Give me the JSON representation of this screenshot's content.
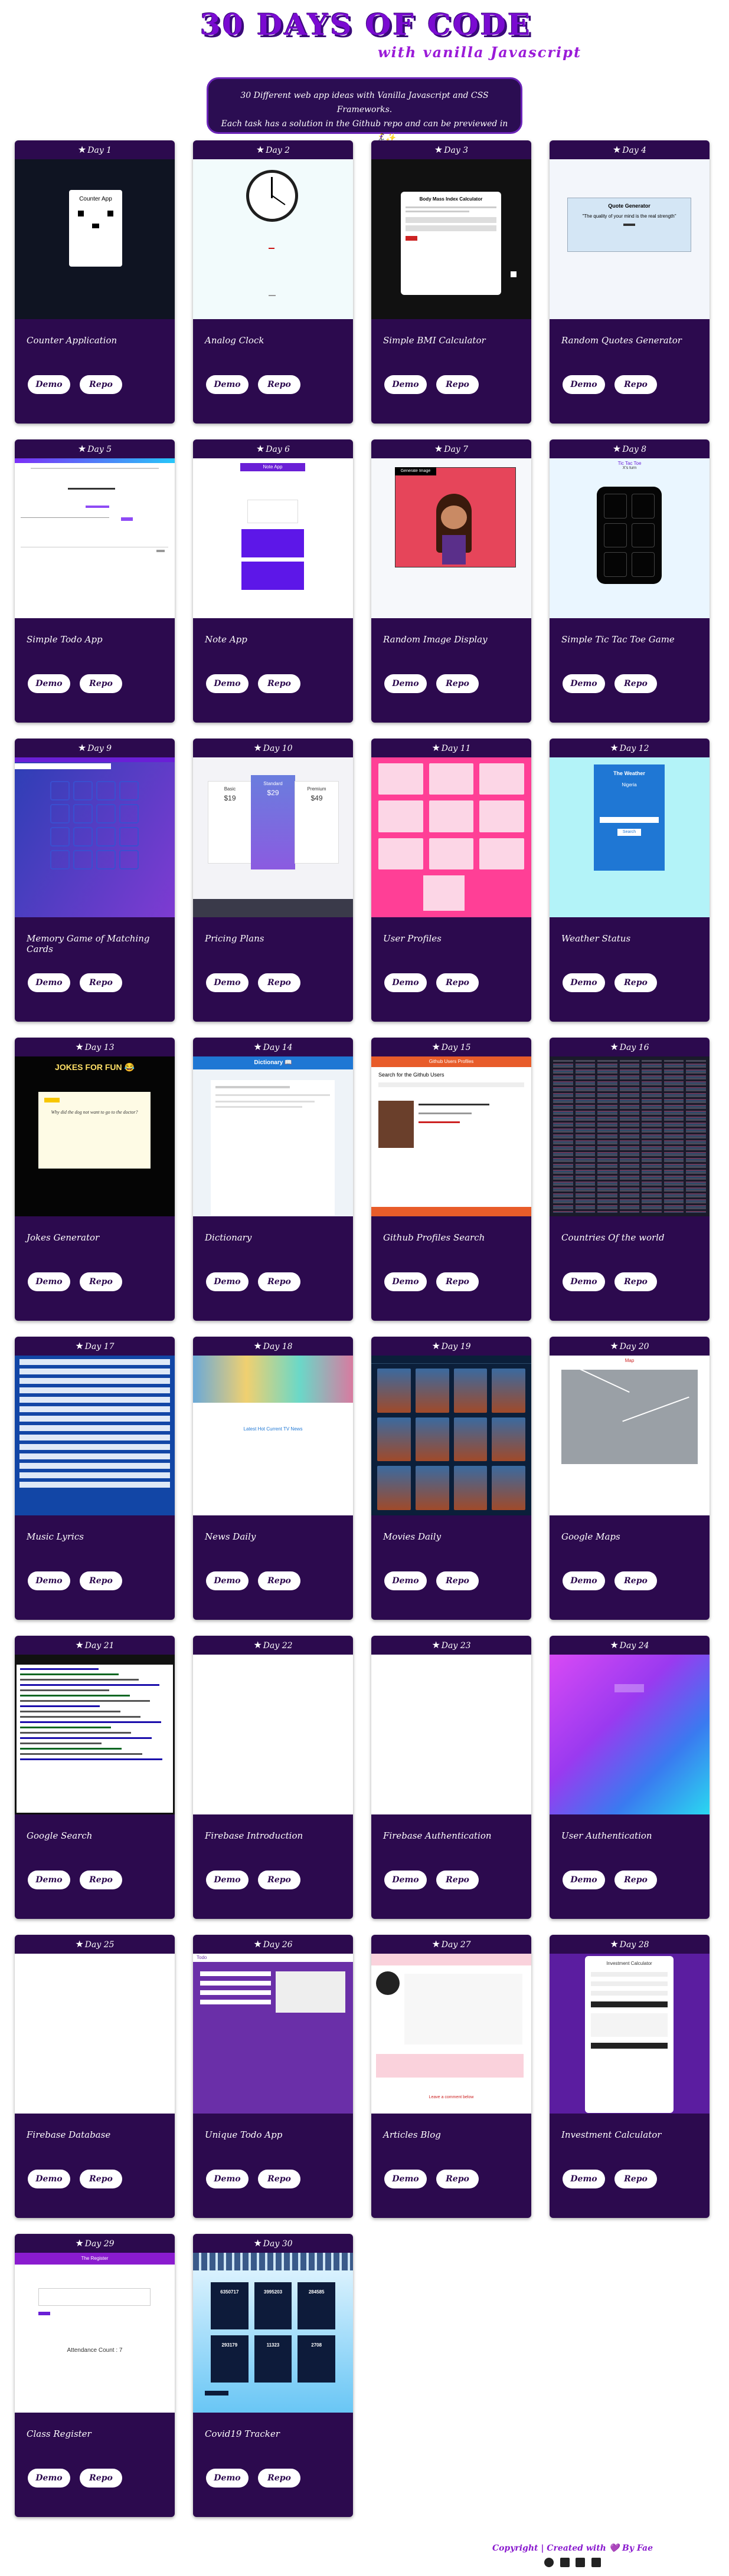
{
  "header": {
    "title": "30 DAYS OF CODE",
    "subtitle": "with vanilla Javascript"
  },
  "intro": {
    "line1": "30 Different web app ideas with Vanilla Javascript and CSS Frameworks.",
    "line2": "Each task has a solution in the Github repo and can be previewed in the demo 🏃‍♀️✨"
  },
  "buttons": {
    "demo": "Demo",
    "repo": "Repo"
  },
  "projects": [
    {
      "day": "Day 1",
      "name": "Counter Application",
      "preview": "counter"
    },
    {
      "day": "Day 2",
      "name": "Analog Clock",
      "preview": "clock"
    },
    {
      "day": "Day 3",
      "name": "Simple BMI Calculator",
      "preview": "bmi"
    },
    {
      "day": "Day 4",
      "name": "Random Quotes Generator",
      "preview": "quotes"
    },
    {
      "day": "Day 5",
      "name": "Simple Todo App",
      "preview": "todo"
    },
    {
      "day": "Day 6",
      "name": "Note App",
      "preview": "note"
    },
    {
      "day": "Day 7",
      "name": "Random Image Display",
      "preview": "image"
    },
    {
      "day": "Day 8",
      "name": "Simple Tic Tac Toe Game",
      "preview": "tictactoe"
    },
    {
      "day": "Day 9",
      "name": "Memory Game of Matching Cards",
      "preview": "memory"
    },
    {
      "day": "Day 10",
      "name": "Pricing Plans",
      "preview": "pricing"
    },
    {
      "day": "Day 11",
      "name": "User Profiles",
      "preview": "profiles"
    },
    {
      "day": "Day 12",
      "name": "Weather Status",
      "preview": "weather"
    },
    {
      "day": "Day 13",
      "name": "Jokes Generator",
      "preview": "jokes"
    },
    {
      "day": "Day 14",
      "name": "Dictionary",
      "preview": "dictionary"
    },
    {
      "day": "Day 15",
      "name": "Github Profiles Search",
      "preview": "github"
    },
    {
      "day": "Day 16",
      "name": "Countries Of the world",
      "preview": "countries"
    },
    {
      "day": "Day 17",
      "name": "Music Lyrics",
      "preview": "lyrics"
    },
    {
      "day": "Day 18",
      "name": "News Daily",
      "preview": "news"
    },
    {
      "day": "Day 19",
      "name": "Movies Daily",
      "preview": "movies"
    },
    {
      "day": "Day 20",
      "name": "Google Maps",
      "preview": "maps"
    },
    {
      "day": "Day 21",
      "name": "Google Search",
      "preview": "search"
    },
    {
      "day": "Day 22",
      "name": "Firebase Introduction",
      "preview": "blank"
    },
    {
      "day": "Day 23",
      "name": "Firebase Authentication",
      "preview": "blank"
    },
    {
      "day": "Day 24",
      "name": "User Authentication",
      "preview": "auth"
    },
    {
      "day": "Day 25",
      "name": "Firebase Database",
      "preview": "blank"
    },
    {
      "day": "Day 26",
      "name": "Unique Todo App",
      "preview": "uniquetodo"
    },
    {
      "day": "Day 27",
      "name": "Articles Blog",
      "preview": "blog"
    },
    {
      "day": "Day 28",
      "name": "Investment Calculator",
      "preview": "investment"
    },
    {
      "day": "Day 29",
      "name": "Class Register",
      "preview": "register"
    },
    {
      "day": "Day 30",
      "name": "Covid19 Tracker",
      "preview": "covid"
    }
  ],
  "preview_text": {
    "counter_title": "Counter App",
    "quotes_title": "Quote Generator",
    "quotes_body": "\"The quality of your mind is the real strength\"",
    "bmi_title": "Body Mass Index Calculator",
    "note_header": "Note App",
    "image_button": "Generate Image",
    "tictactoe_title": "Tic Tac Toe",
    "tictactoe_status": "X's turn",
    "weather_title": "The Weather",
    "weather_city": "Nigeria",
    "weather_button": "Search",
    "jokes_title": "JOKES FOR FUN 😂",
    "jokes_body": "Why did the dog not want to go to the doctor?",
    "dictionary_title": "Dictionary 📖",
    "github_title": "Github Users Profiles",
    "github_search": "Search for the Github Users",
    "news_banner": "Latest Hot Current TV News",
    "maps_title": "Map",
    "pricing_plans": [
      "Basic",
      "Standard",
      "Premium"
    ],
    "pricing_prices": [
      "$19",
      "$29",
      "$49"
    ],
    "register_header": "The Register",
    "register_subtitle": "Attendance Count : 7",
    "investment_title": "Investment Calculator",
    "covid_stats": [
      "6350717",
      "3995203",
      "284585",
      "293179",
      "11323",
      "2708"
    ],
    "blog_footer": "Leave a comment below",
    "uniquetodo_header": "Todo"
  },
  "footer": {
    "text": "Copyright | Created with 💜 By Fae",
    "icons": [
      "github-icon",
      "twitter-icon",
      "linkedin-icon",
      "email-icon"
    ]
  }
}
